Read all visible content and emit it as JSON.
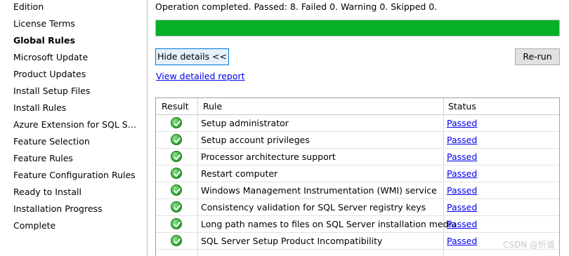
{
  "sidebar": {
    "items": [
      {
        "label": "Edition"
      },
      {
        "label": "License Terms"
      },
      {
        "label": "Global Rules",
        "active": true
      },
      {
        "label": "Microsoft Update"
      },
      {
        "label": "Product Updates"
      },
      {
        "label": "Install Setup Files"
      },
      {
        "label": "Install Rules"
      },
      {
        "label": "Azure Extension for SQL Ser..."
      },
      {
        "label": "Feature Selection"
      },
      {
        "label": "Feature Rules"
      },
      {
        "label": "Feature Configuration Rules"
      },
      {
        "label": "Ready to Install"
      },
      {
        "label": "Installation Progress"
      },
      {
        "label": "Complete"
      }
    ]
  },
  "summary": "Operation completed. Passed: 8.   Failed 0.   Warning 0.   Skipped 0.",
  "progress": {
    "fraction": 1.0,
    "color": "#06b025"
  },
  "buttons": {
    "hide_details": "Hide details <<",
    "rerun": "Re-run"
  },
  "report_link": "View detailed report",
  "table": {
    "headers": [
      "Result",
      "Rule",
      "Status"
    ],
    "rows": [
      {
        "rule": "Setup administrator",
        "status": "Passed",
        "result_icon": "check-circle-icon"
      },
      {
        "rule": "Setup account privileges",
        "status": "Passed",
        "result_icon": "check-circle-icon"
      },
      {
        "rule": "Processor architecture support",
        "status": "Passed",
        "result_icon": "check-circle-icon"
      },
      {
        "rule": "Restart computer",
        "status": "Passed",
        "result_icon": "check-circle-icon"
      },
      {
        "rule": "Windows Management Instrumentation (WMI) service",
        "status": "Passed",
        "result_icon": "check-circle-icon"
      },
      {
        "rule": "Consistency validation for SQL Server registry keys",
        "status": "Passed",
        "result_icon": "check-circle-icon"
      },
      {
        "rule": "Long path names to files on SQL Server installation media",
        "status": "Passed",
        "result_icon": "check-circle-icon"
      },
      {
        "rule": "SQL Server Setup Product Incompatibility",
        "status": "Passed",
        "result_icon": "check-circle-icon"
      }
    ]
  },
  "watermark": "CSDN @忻道"
}
